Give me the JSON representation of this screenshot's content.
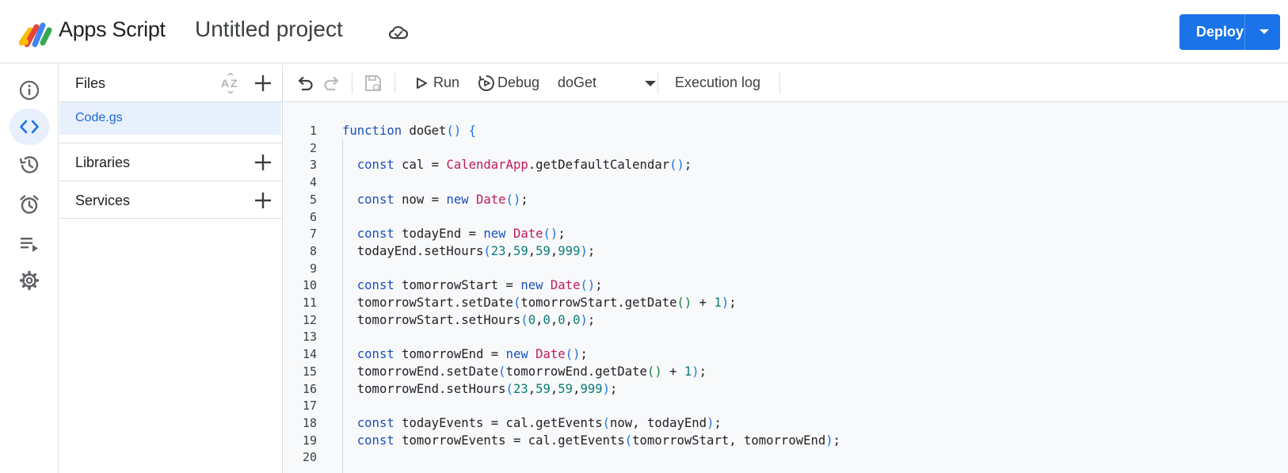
{
  "header": {
    "app_name": "Apps Script",
    "project_title": "Untitled project",
    "deploy_label": "Deploy"
  },
  "leftnav": {
    "items": [
      {
        "name": "overview",
        "icon": "info-icon"
      },
      {
        "name": "editor",
        "icon": "code-icon",
        "active": true
      },
      {
        "name": "project-history",
        "icon": "history-icon"
      },
      {
        "name": "triggers",
        "icon": "alarm-icon"
      },
      {
        "name": "executions",
        "icon": "executions-icon"
      },
      {
        "name": "project-settings",
        "icon": "gear-icon"
      }
    ]
  },
  "files_panel": {
    "title": "Files",
    "files": [
      "Code.gs"
    ],
    "libraries_label": "Libraries",
    "services_label": "Services"
  },
  "toolbar": {
    "run_label": "Run",
    "debug_label": "Debug",
    "function_select": "doGet",
    "execution_log_label": "Execution log"
  },
  "colors": {
    "accent": "#1a73e8",
    "keyword": "#1a4fbd",
    "class": "#c2185b",
    "number": "#0b7c77",
    "active_bg": "#e8f0fe"
  },
  "editor": {
    "lines": [
      {
        "n": "1",
        "text": "function doGet() {"
      },
      {
        "n": "2",
        "text": ""
      },
      {
        "n": "3",
        "text": "  const cal = CalendarApp.getDefaultCalendar();"
      },
      {
        "n": "4",
        "text": ""
      },
      {
        "n": "5",
        "text": "  const now = new Date();"
      },
      {
        "n": "6",
        "text": ""
      },
      {
        "n": "7",
        "text": "  const todayEnd = new Date();"
      },
      {
        "n": "8",
        "text": "  todayEnd.setHours(23,59,59,999);"
      },
      {
        "n": "9",
        "text": ""
      },
      {
        "n": "10",
        "text": "  const tomorrowStart = new Date();"
      },
      {
        "n": "11",
        "text": "  tomorrowStart.setDate(tomorrowStart.getDate() + 1);"
      },
      {
        "n": "12",
        "text": "  tomorrowStart.setHours(0,0,0,0);"
      },
      {
        "n": "13",
        "text": ""
      },
      {
        "n": "14",
        "text": "  const tomorrowEnd = new Date();"
      },
      {
        "n": "15",
        "text": "  tomorrowEnd.setDate(tomorrowEnd.getDate() + 1);"
      },
      {
        "n": "16",
        "text": "  tomorrowEnd.setHours(23,59,59,999);"
      },
      {
        "n": "17",
        "text": ""
      },
      {
        "n": "18",
        "text": "  const todayEvents = cal.getEvents(now, todayEnd);"
      },
      {
        "n": "19",
        "text": "  const tomorrowEvents = cal.getEvents(tomorrowStart, tomorrowEnd);"
      },
      {
        "n": "20",
        "text": ""
      }
    ]
  }
}
